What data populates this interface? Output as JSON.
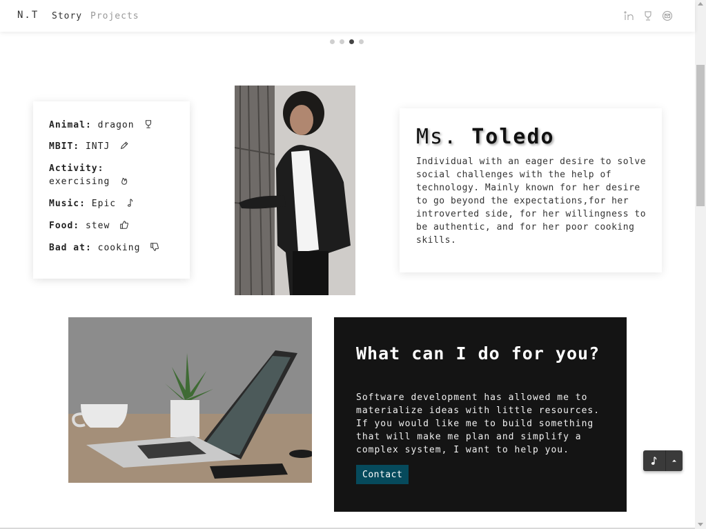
{
  "nav": {
    "brand": "N.T",
    "links": [
      "Story",
      "Projects"
    ],
    "icons": [
      "linkedin-icon",
      "trophy-icon",
      "mail-icon"
    ]
  },
  "carousel": {
    "slides": 4,
    "active_index": 2
  },
  "facts": [
    {
      "label": "Animal:",
      "value": "dragon",
      "icon": "trophy-icon"
    },
    {
      "label": "MBIT:",
      "value": "INTJ",
      "icon": "pencil-icon"
    },
    {
      "label": "Activity:",
      "value": "exercising",
      "icon": "fire-icon"
    },
    {
      "label": "Music:",
      "value": "Epic",
      "icon": "music-note-icon"
    },
    {
      "label": "Food:",
      "value": "stew",
      "icon": "thumbs-up-icon"
    },
    {
      "label": "Bad at:",
      "value": "cooking",
      "icon": "thumbs-down-icon"
    }
  ],
  "bio": {
    "title_first": "Ms.",
    "title_last": "Toledo",
    "text": "Individual with an eager desire to solve social challenges with the help of technology. Mainly known for her desire to go beyond the expectations,for her introverted side, for her willingness to be authentic, and for her poor cooking skills."
  },
  "cta": {
    "title": "What can I do for you?",
    "text": "Software development has allowed me to materialize ideas with little resources. If you would like me to build something that will make me plan and simplify a complex system, I want to help you.",
    "button_label": "Contact"
  },
  "player": {
    "icons": [
      "music-note-icon",
      "caret-up-icon"
    ]
  },
  "colors": {
    "cta_background": "#141414",
    "contact_button": "#064a5c"
  }
}
